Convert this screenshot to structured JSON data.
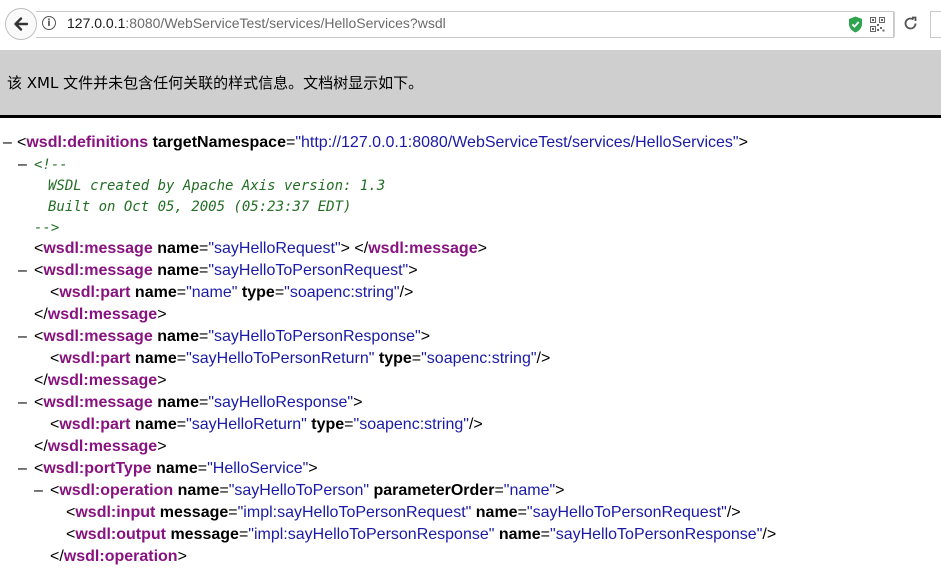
{
  "browser": {
    "url_host": "127.0.0.1",
    "url_rest": ":8080/WebServiceTest/services/HelloServices?wsdl"
  },
  "banner": {
    "text": "该 XML 文件并未包含任何关联的样式信息。文档树显示如下。"
  },
  "xml": {
    "definitions": {
      "tag": "wsdl:definitions",
      "attr": "targetNamespace",
      "value": "\"http://127.0.0.1:8080/WebServiceTest/services/HelloServices\""
    },
    "comment": {
      "open": "<!--",
      "line1": "WSDL created by Apache Axis version: 1.3",
      "line2": "Built on Oct 05, 2005 (05:23:37 EDT)",
      "close": "-->"
    },
    "m1": {
      "tag": "wsdl:message",
      "attr": "name",
      "value": "\"sayHelloRequest\"",
      "close": "wsdl:message"
    },
    "m2": {
      "tag": "wsdl:message",
      "attr": "name",
      "value": "\"sayHelloToPersonRequest\"",
      "part": {
        "tag": "wsdl:part",
        "a1": "name",
        "v1": "\"name\"",
        "a2": "type",
        "v2": "\"soapenc:string\""
      },
      "close": "wsdl:message"
    },
    "m3": {
      "tag": "wsdl:message",
      "attr": "name",
      "value": "\"sayHelloToPersonResponse\"",
      "part": {
        "tag": "wsdl:part",
        "a1": "name",
        "v1": "\"sayHelloToPersonReturn\"",
        "a2": "type",
        "v2": "\"soapenc:string\""
      },
      "close": "wsdl:message"
    },
    "m4": {
      "tag": "wsdl:message",
      "attr": "name",
      "value": "\"sayHelloResponse\"",
      "part": {
        "tag": "wsdl:part",
        "a1": "name",
        "v1": "\"sayHelloReturn\"",
        "a2": "type",
        "v2": "\"soapenc:string\""
      },
      "close": "wsdl:message"
    },
    "porttype": {
      "tag": "wsdl:portType",
      "attr": "name",
      "value": "\"HelloService\""
    },
    "operation": {
      "tag": "wsdl:operation",
      "a1": "name",
      "v1": "\"sayHelloToPerson\"",
      "a2": "parameterOrder",
      "v2": "\"name\"",
      "close": "wsdl:operation"
    },
    "input": {
      "tag": "wsdl:input",
      "a1": "message",
      "v1": "\"impl:sayHelloToPersonRequest\"",
      "a2": "name",
      "v2": "\"sayHelloToPersonRequest\""
    },
    "output": {
      "tag": "wsdl:output",
      "a1": "message",
      "v1": "\"impl:sayHelloToPersonResponse\"",
      "a2": "name",
      "v2": "\"sayHelloToPersonResponse\""
    },
    "toggle_symbol": "–"
  }
}
